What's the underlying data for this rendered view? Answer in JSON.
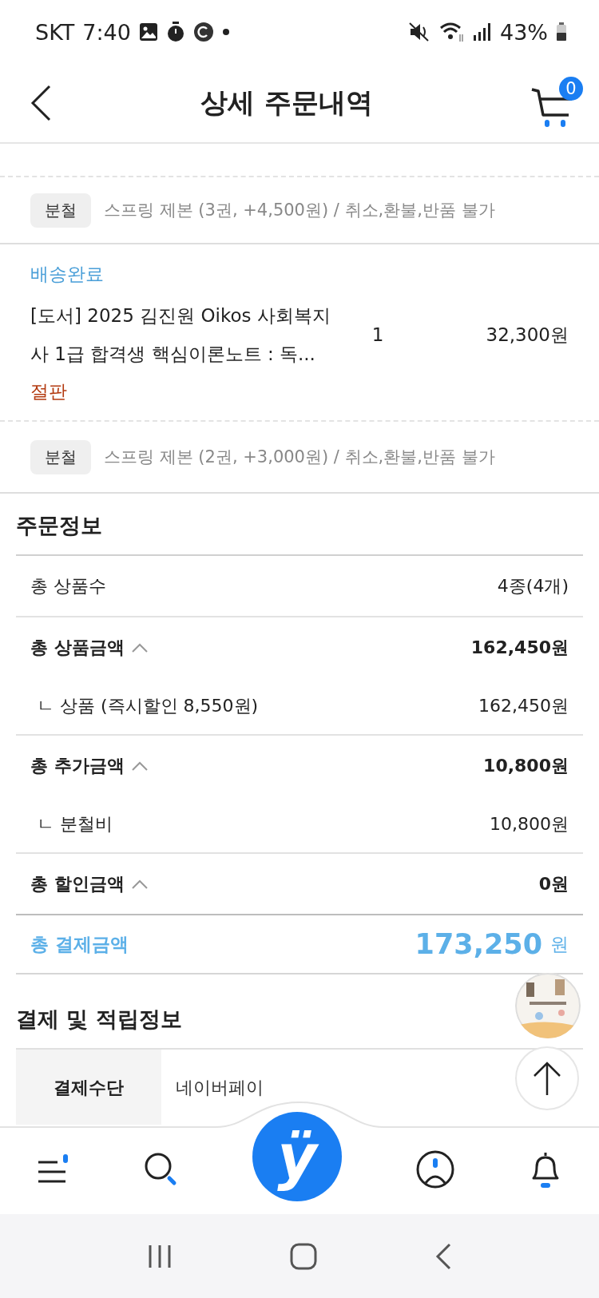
{
  "status_bar": {
    "carrier": "SKT",
    "time": "7:40",
    "battery": "43%"
  },
  "header": {
    "title": "상세 주문내역",
    "cart_count": "0"
  },
  "order_items": [
    {
      "kind": "option",
      "tag": "분철",
      "text": "스프링 제본 (3권, +4,500원) / 취소,환불,반품 불가"
    },
    {
      "kind": "product",
      "status": "배송완료",
      "title": "[도서] 2025 김진원 Oikos 사회복지사 1급 합격생 핵심이론노트 : 독...",
      "quantity": "1",
      "price": "32,300원",
      "note": "절판"
    },
    {
      "kind": "option",
      "tag": "분철",
      "text": "스프링 제본 (2권, +3,000원) / 취소,환불,반품 불가"
    }
  ],
  "order_info": {
    "title": "주문정보",
    "rows": [
      {
        "kind": "plain",
        "label": "총 상품수",
        "value": "4종(4개)"
      },
      {
        "kind": "group",
        "label": "총 상품금액",
        "value": "162,450원",
        "expanded": true,
        "children": [
          {
            "label": "ㄴ 상품 (즉시할인 8,550원)",
            "value": "162,450원"
          }
        ]
      },
      {
        "kind": "group",
        "label": "총 추가금액",
        "value": "10,800원",
        "expanded": true,
        "children": [
          {
            "label": "ㄴ 분철비",
            "value": "10,800원"
          }
        ]
      },
      {
        "kind": "group",
        "label": "총 할인금액",
        "value": "0원",
        "expanded": true
      }
    ],
    "total": {
      "label": "총 결제금액",
      "amount": "173,250",
      "unit": "원"
    }
  },
  "payment": {
    "title": "결제 및 적립정보",
    "rows": [
      {
        "label": "결제수단",
        "value": "네이버페이"
      }
    ]
  },
  "bottom_nav": {
    "logo": "ÿ"
  }
}
